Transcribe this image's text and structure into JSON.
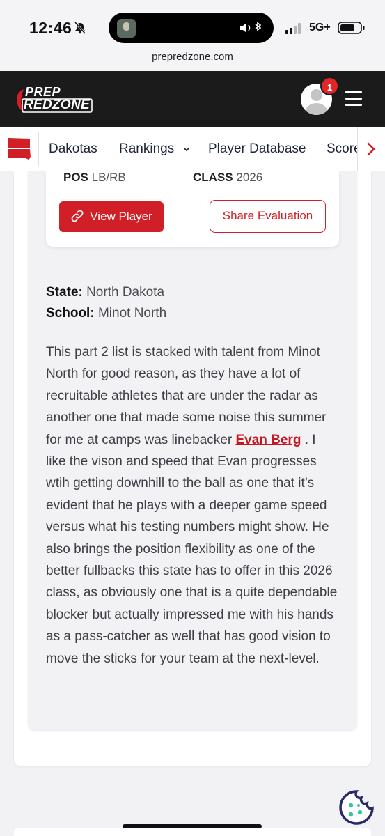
{
  "status_bar": {
    "time": "12:46",
    "network": "5G+"
  },
  "browser": {
    "url": "prepredzone.com"
  },
  "header": {
    "logo_top": "PREP",
    "logo_bottom": "REDZONE",
    "notification_count": "1"
  },
  "nav": {
    "items": [
      {
        "label": "Dakotas"
      },
      {
        "label": "Rankings"
      },
      {
        "label": "Player Database"
      },
      {
        "label": "Scores"
      }
    ]
  },
  "player_card": {
    "pos_label": "POS",
    "pos_value": "LB/RB",
    "class_label": "CLASS",
    "class_value": "2026",
    "view_button": "View Player",
    "share_button": "Share Evaluation"
  },
  "article": {
    "state_label": "State:",
    "state_value": "North Dakota",
    "school_label": "School:",
    "school_value": "Minot North",
    "text_before": "This part 2 list is stacked with talent from Minot North for good reason, as they have a lot of recruitable athletes that are under the radar as another one that made some noise this summer for me at camps was linebacker ",
    "player_link": "Evan Berg",
    "text_after": " . I like the vison and speed that Evan progresses wtih getting downhill to the ball as one that it’s evident that he plays with a deeper game speed versus what his testing numbers might show. He also brings the position flexibility as one of the better fullbacks this state has to offer in this 2026 class, as obviously one that is a quite dependable blocker but actually impressed me with his hands as a pass-catcher as well that has good vision to move the sticks for your team at the next-level."
  },
  "colors": {
    "brand_red": "#d01f26",
    "header_bg": "#1b1b1c"
  }
}
